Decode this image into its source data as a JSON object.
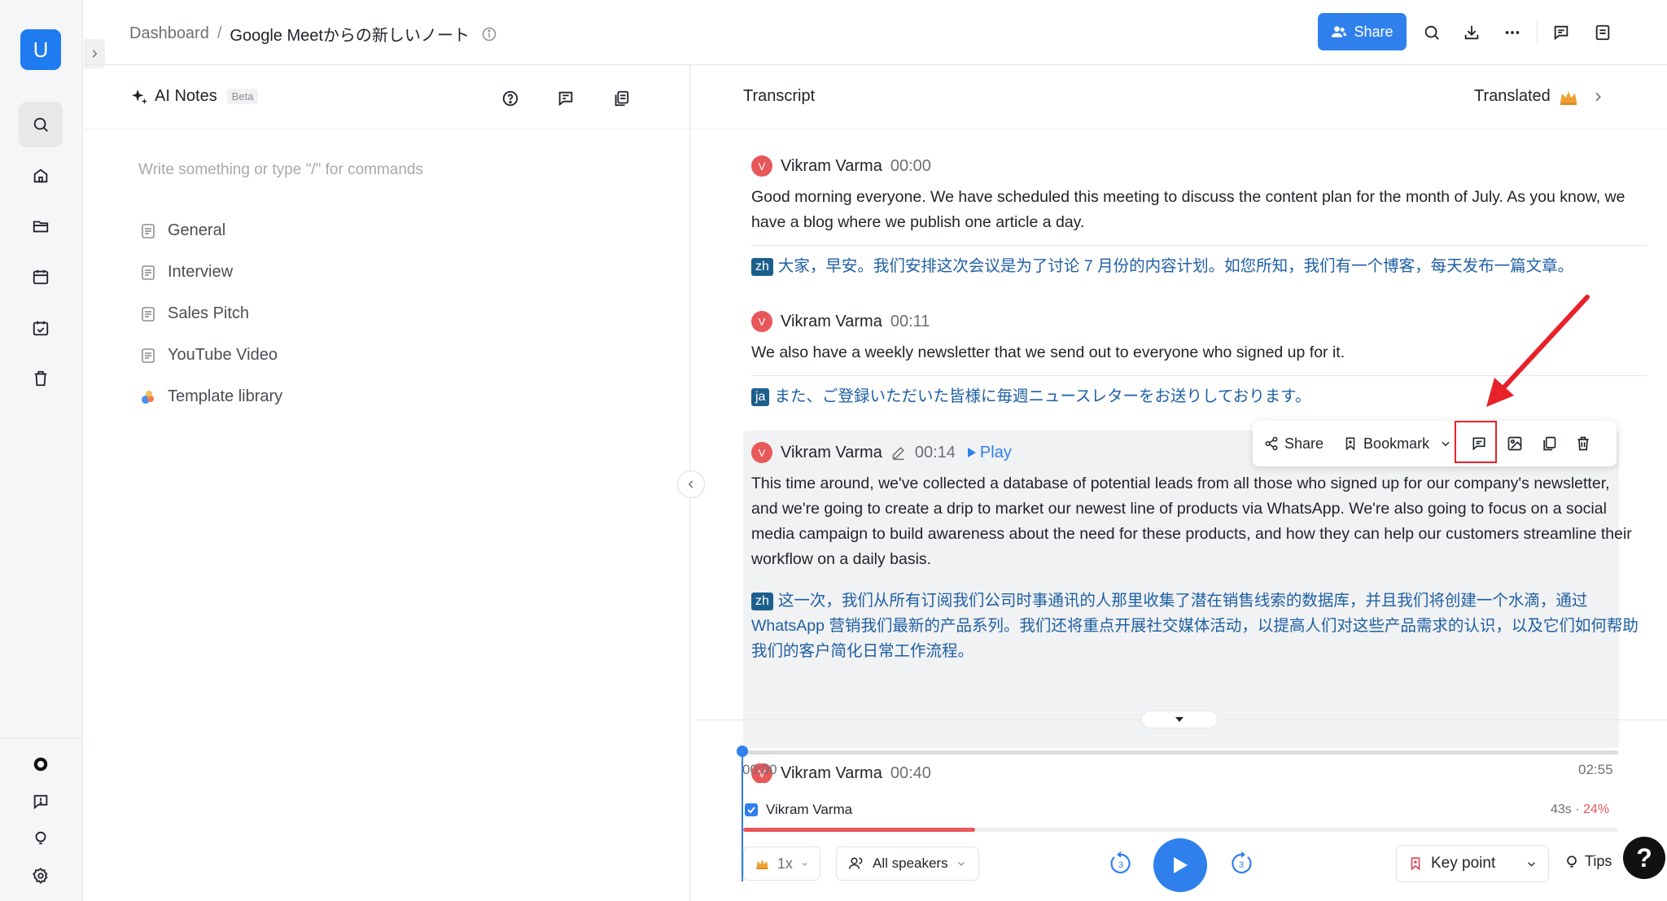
{
  "rail": {
    "avatar_letter": "U",
    "top_icons": [
      "search-icon",
      "home-icon",
      "folder-icon",
      "calendar-icon",
      "calendar-check-icon",
      "trash-icon"
    ],
    "bottom_icons": [
      "brand-icon",
      "feedback-icon",
      "idea-icon",
      "settings-icon"
    ]
  },
  "header": {
    "breadcrumb_root": "Dashboard",
    "breadcrumb_sep": "/",
    "breadcrumb_current": "Google Meetからの新しいノート",
    "share_label": "Share",
    "accent": "#2f80ed"
  },
  "notes": {
    "title": "AI Notes",
    "badge": "Beta",
    "placeholder": "Write something or type \"/\" for commands",
    "templates": [
      {
        "label": "General"
      },
      {
        "label": "Interview"
      },
      {
        "label": "Sales Pitch"
      },
      {
        "label": "YouTube Video"
      },
      {
        "label": "Template library"
      }
    ]
  },
  "transcript": {
    "title": "Transcript",
    "translated_label": "Translated",
    "segments": [
      {
        "avatar": "V",
        "speaker": "Vikram Varma",
        "time": "00:00",
        "text": "Good morning everyone. We have scheduled this meeting to discuss the content plan for the month of July. As you know, we have a blog where we publish one article a day.",
        "lang": "zh",
        "translation": "大家，早安。我们安排这次会议是为了讨论 7 月份的内容计划。如您所知，我们有一个博客，每天发布一篇文章。"
      },
      {
        "avatar": "V",
        "speaker": "Vikram Varma",
        "time": "00:11",
        "text": "We also have a weekly newsletter that we send out to everyone who signed up for it.",
        "lang": "ja",
        "translation": "また、ご登録いただいた皆様に毎週ニュースレターをお送りしております。"
      },
      {
        "avatar": "V",
        "speaker": "Vikram Varma",
        "time": "00:14",
        "play_label": "Play",
        "text": "This time around, we've collected a database of potential leads from all those who signed up for our company's newsletter, and we're going to create a drip to market our newest line of products via WhatsApp. We're also going to focus on a social media campaign to build awareness about the need for these products, and how they can help our customers streamline their workflow on a daily basis.",
        "lang": "zh",
        "translation": "这一次，我们从所有订阅我们公司时事通讯的人那里收集了潜在销售线索的数据库，并且我们将创建一个水滴，通过 WhatsApp 营销我们最新的产品系列。我们还将重点开展社交媒体活动，以提高人们对这些产品需求的认识，以及它们如何帮助我们的客户简化日常工作流程。"
      },
      {
        "avatar": "V",
        "speaker": "Vikram Varma",
        "time": "00:40"
      }
    ],
    "toolbar": {
      "share_label": "Share",
      "bookmark_label": "Bookmark"
    }
  },
  "player": {
    "time_start": "00:00",
    "time_end": "02:55",
    "progress": 0,
    "speaker_name": "Vikram Varma",
    "speaker_duration": "43s",
    "speaker_dot": "·",
    "speaker_pct": "24%",
    "speed_label": "1x",
    "speakers_filter": "All speakers",
    "skip_back": "3",
    "skip_forward": "3",
    "keypoint_label": "Key point",
    "tips_label": "Tips",
    "help_label": "?"
  }
}
